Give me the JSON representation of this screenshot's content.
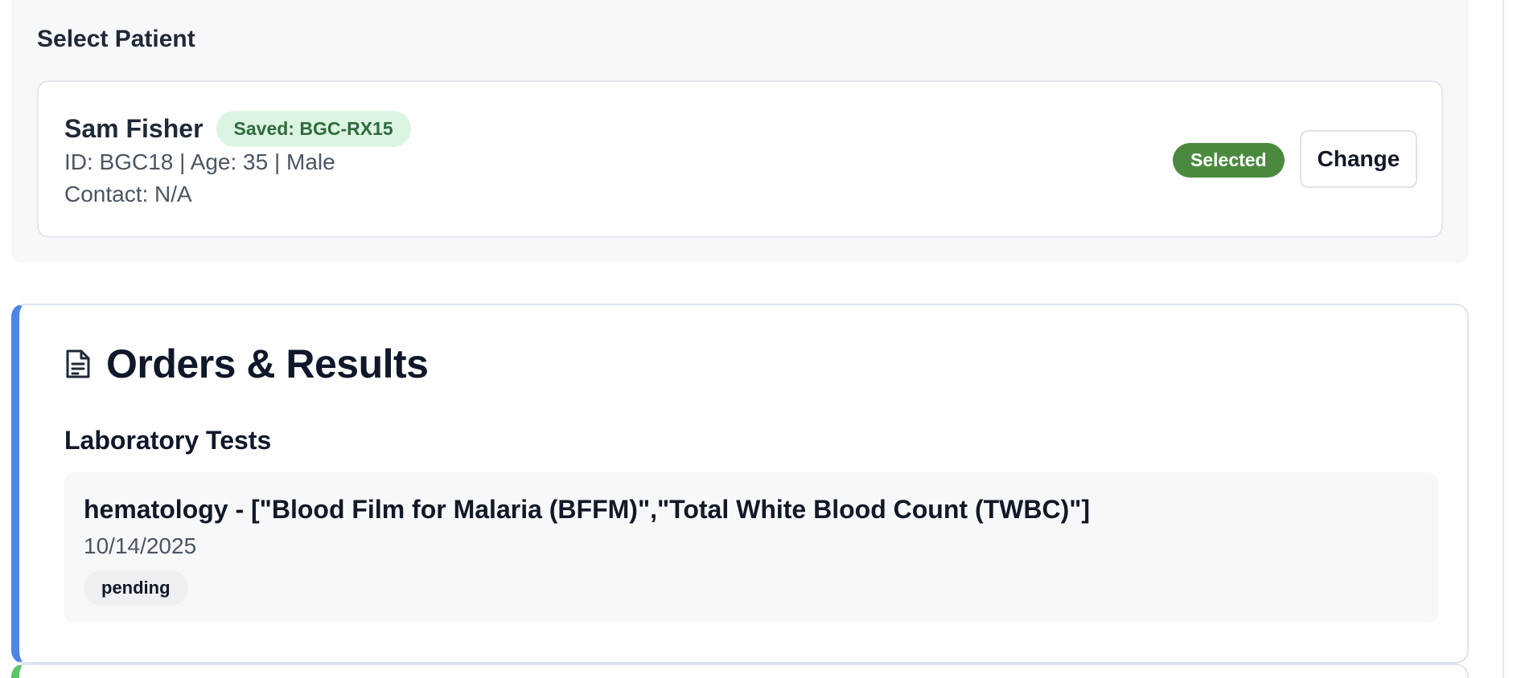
{
  "patient_section": {
    "title": "Select Patient",
    "patient": {
      "name": "Sam Fisher",
      "saved_badge": "Saved: BGC-RX15",
      "id_line": "ID: BGC18 | Age: 35 | Male",
      "contact_line": "Contact: N/A"
    },
    "selected_label": "Selected",
    "change_label": "Change"
  },
  "orders": {
    "title": "Orders & Results",
    "icon": "document-icon",
    "lab_heading": "Laboratory Tests",
    "lab_tests": [
      {
        "title": "hematology - [\"Blood Film for Malaria (BFFM)\",\"Total White Blood Count (TWBC)\"]",
        "date": "10/14/2025",
        "status": "pending"
      }
    ]
  },
  "colors": {
    "orders_accent": "#4d84e8",
    "next_card_accent": "#5cc46a",
    "selected_pill": "#4b8a3e",
    "saved_badge_bg": "#dcf5e3"
  }
}
